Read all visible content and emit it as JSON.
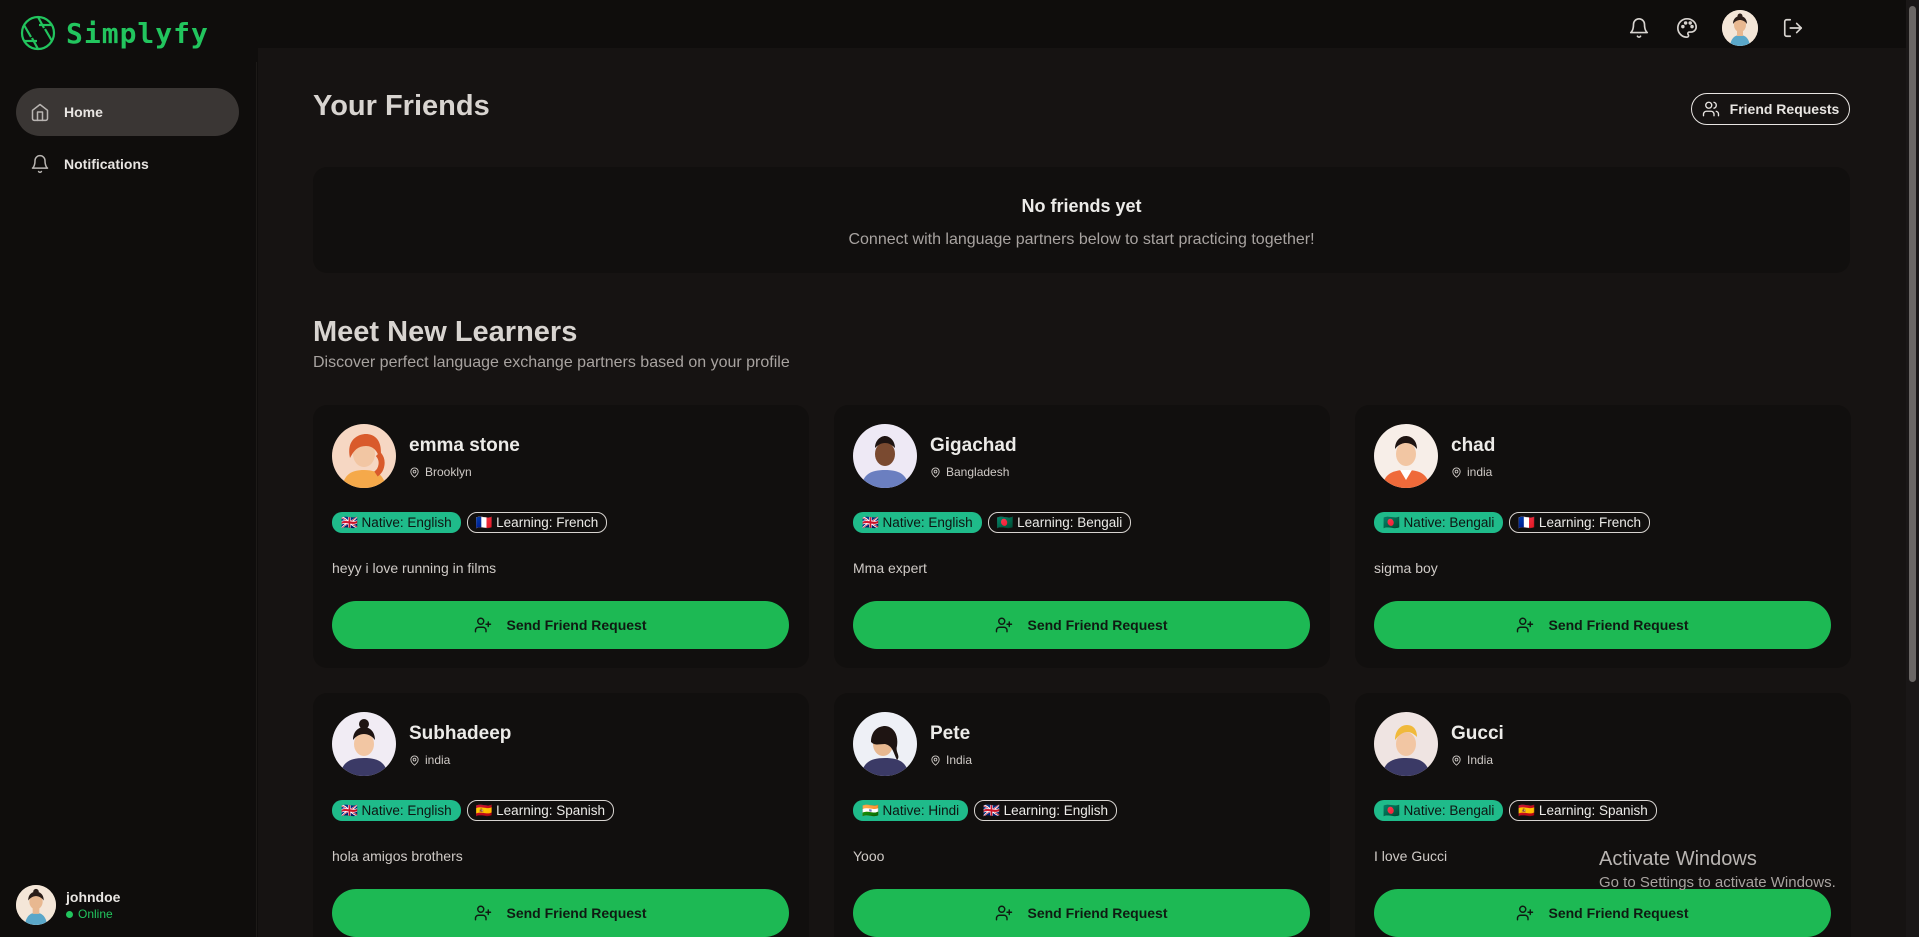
{
  "app": {
    "name": "Simplyfy",
    "brand_color": "#22c55e"
  },
  "topbar": {
    "icons": [
      "bell-icon",
      "palette-icon",
      "avatar",
      "logout-icon"
    ]
  },
  "sidebar": {
    "items": [
      {
        "label": "Home",
        "icon": "home-icon",
        "active": true
      },
      {
        "label": "Notifications",
        "icon": "bell-icon",
        "active": false
      }
    ],
    "user": {
      "name": "johndoe",
      "status": "Online"
    }
  },
  "friends": {
    "title": "Your Friends",
    "requests_button": "Friend Requests",
    "empty_title": "No friends yet",
    "empty_subtitle": "Connect with language partners below to start practicing together!"
  },
  "learners": {
    "title": "Meet New Learners",
    "subtitle": "Discover perfect language exchange partners based on your profile",
    "button_label": "Send Friend Request",
    "cards": [
      {
        "name": "emma stone",
        "location": "Brooklyn",
        "native": "🇬🇧 Native: English",
        "learning": "🇫🇷 Learning: French",
        "bio": "heyy i love running in films"
      },
      {
        "name": "Gigachad",
        "location": "Bangladesh",
        "native": "🇬🇧 Native: English",
        "learning": "🇧🇩 Learning: Bengali",
        "bio": "Mma expert"
      },
      {
        "name": "chad",
        "location": "india",
        "native": "🇧🇩 Native: Bengali",
        "learning": "🇫🇷 Learning: French",
        "bio": "sigma boy"
      },
      {
        "name": "Subhadeep",
        "location": "india",
        "native": "🇬🇧 Native: English",
        "learning": "🇪🇸 Learning: Spanish",
        "bio": "hola amigos brothers"
      },
      {
        "name": "Pete",
        "location": "India",
        "native": "🇮🇳 Native: Hindi",
        "learning": "🇬🇧 Learning: English",
        "bio": "Yooo"
      },
      {
        "name": "Gucci",
        "location": "India",
        "native": "🇧🇩 Native: Bengali",
        "learning": "🇪🇸 Learning: Spanish",
        "bio": "I love Gucci"
      }
    ]
  },
  "watermark": {
    "line1": "Activate Windows",
    "line2": "Go to Settings to activate Windows."
  }
}
